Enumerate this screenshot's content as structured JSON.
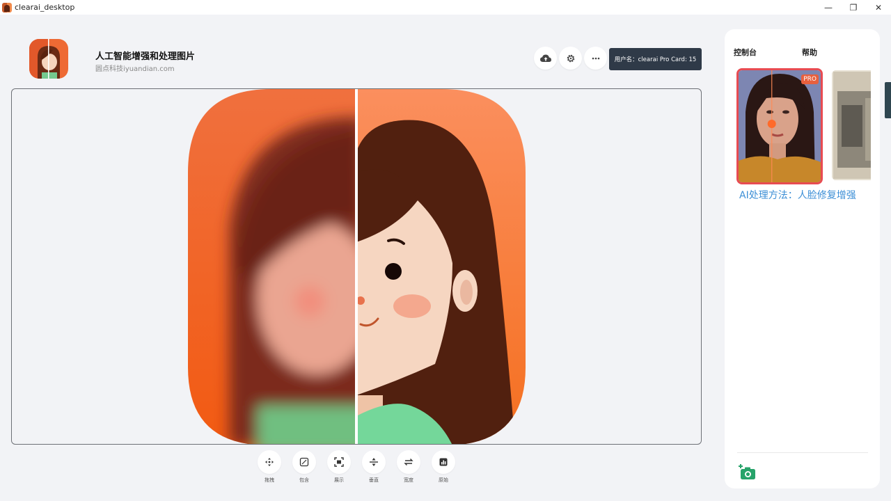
{
  "window": {
    "title": "clearai_desktop",
    "controls": {
      "minimize": "—",
      "maximize": "❐",
      "close": "✕"
    }
  },
  "header": {
    "title": "人工智能增强和处理图片",
    "subtitle": "圆点科技iyuandian.com",
    "actions": [
      {
        "icon": "cloud-upload-icon"
      },
      {
        "icon": "gear-icon"
      },
      {
        "icon": "more-icon"
      }
    ],
    "user_badge": "用户名：clearai Pro Card: 15"
  },
  "tools": [
    {
      "label": "拖拽",
      "icon": "move-icon"
    },
    {
      "label": "包含",
      "icon": "fit-icon"
    },
    {
      "label": "展示",
      "icon": "fullscreen-icon"
    },
    {
      "label": "垂直",
      "icon": "split-vertical-icon"
    },
    {
      "label": "宽度",
      "icon": "swap-icon"
    },
    {
      "label": "原始",
      "icon": "original-icon"
    }
  ],
  "panel": {
    "tabs": [
      "控制台",
      "帮助"
    ],
    "pro_badge": "PRO",
    "method_label": "AI处理方法：人脸修复增强"
  },
  "colors": {
    "accent_red": "#e84b52",
    "link_blue": "#3d8fd6",
    "badge_dark": "#2f3a48",
    "orange": "#f07a3e"
  }
}
